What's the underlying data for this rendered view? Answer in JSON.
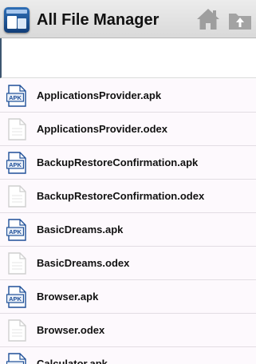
{
  "app": {
    "title": "All File Manager",
    "icon": "file-manager-app-icon"
  },
  "toolbar": {
    "home_icon": "home-icon",
    "up_icon": "folder-up-icon"
  },
  "colors": {
    "appbar": "#dedede",
    "row_background": "#fdf9fd",
    "apk_icon_blue": "#1e4f98",
    "file_icon_gray": "#cfcfcf"
  },
  "files": [
    {
      "name": "ApplicationsProvider.apk",
      "type": "apk",
      "icon_label": "APK"
    },
    {
      "name": "ApplicationsProvider.odex",
      "type": "odex",
      "icon_label": ""
    },
    {
      "name": "BackupRestoreConfirmation.apk",
      "type": "apk",
      "icon_label": "APK"
    },
    {
      "name": "BackupRestoreConfirmation.odex",
      "type": "odex",
      "icon_label": ""
    },
    {
      "name": "BasicDreams.apk",
      "type": "apk",
      "icon_label": "APK"
    },
    {
      "name": "BasicDreams.odex",
      "type": "odex",
      "icon_label": ""
    },
    {
      "name": "Browser.apk",
      "type": "apk",
      "icon_label": "APK"
    },
    {
      "name": "Browser.odex",
      "type": "odex",
      "icon_label": ""
    },
    {
      "name": "Calculator.apk",
      "type": "apk",
      "icon_label": "APK"
    }
  ]
}
